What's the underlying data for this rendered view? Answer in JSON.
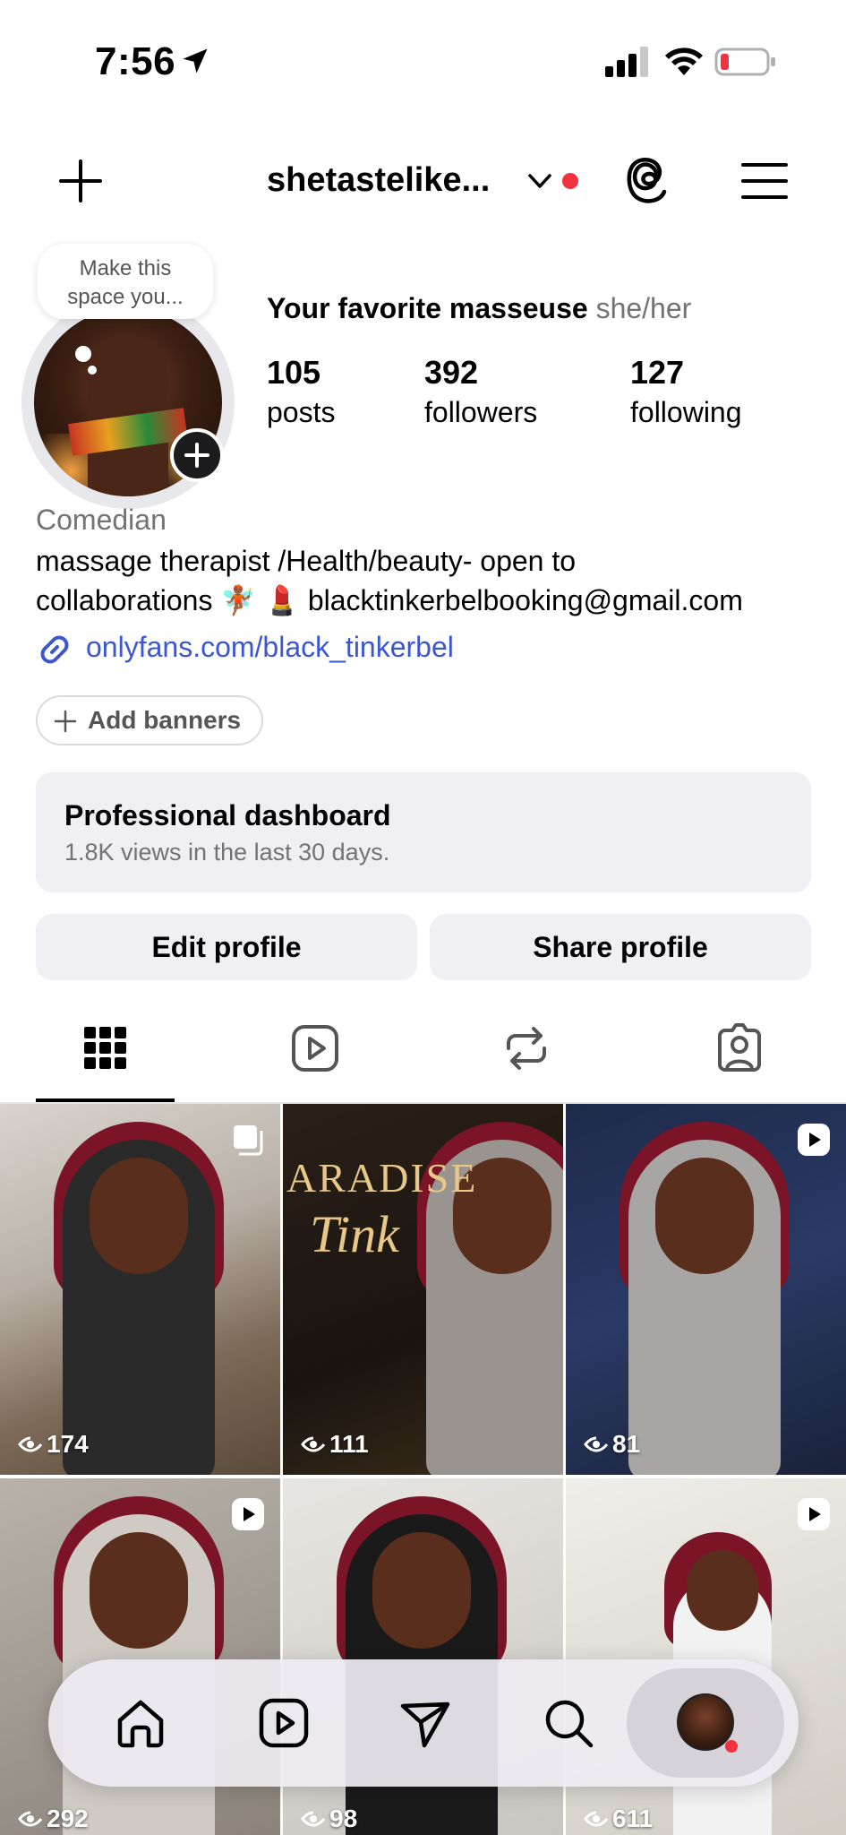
{
  "status_bar": {
    "time": "7:56"
  },
  "header": {
    "username": "shetastelike...",
    "notification_dot_color": "#f2323e"
  },
  "profile": {
    "note": [
      "Make this",
      "space you..."
    ],
    "display_name": "Your favorite masseuse",
    "pronouns": "she/her",
    "stats": [
      {
        "value": "105",
        "label": "posts"
      },
      {
        "value": "392",
        "label": "followers"
      },
      {
        "value": "127",
        "label": "following"
      }
    ],
    "category": "Comedian",
    "bio_line1": "massage therapist /Health/beauty- open to",
    "bio_line2": "collaborations 🧚🏾 💄 blacktinkerbelbooking@gmail.com",
    "link": "onlyfans.com/black_tinkerbel",
    "add_banners": "Add banners"
  },
  "dashboard": {
    "title": "Professional dashboard",
    "subtitle": "1.8K views in the last 30 days."
  },
  "buttons": {
    "edit": "Edit profile",
    "share": "Share profile"
  },
  "tabs": [
    {
      "icon": "grid-icon",
      "active": true
    },
    {
      "icon": "reels-icon",
      "active": false
    },
    {
      "icon": "reposts-icon",
      "active": false
    },
    {
      "icon": "tagged-icon",
      "active": false
    }
  ],
  "posts": [
    {
      "views": "174",
      "badge": "multi-post-icon"
    },
    {
      "views": "111",
      "badge": "",
      "overlay_title": "ARADISE",
      "overlay_subtitle": "Tink"
    },
    {
      "views": "81",
      "badge": "reel-icon"
    },
    {
      "views": "292",
      "badge": "reel-icon"
    },
    {
      "views": "98",
      "badge": ""
    },
    {
      "views": "611",
      "badge": "reel-icon"
    }
  ],
  "nav": [
    "home-icon",
    "reels-icon",
    "send-icon",
    "search-icon",
    "profile-avatar"
  ],
  "colors": {
    "link": "#3b56d0",
    "secondary_text": "#737373",
    "button_bg": "#efeff4",
    "hair": "#7a1426"
  }
}
